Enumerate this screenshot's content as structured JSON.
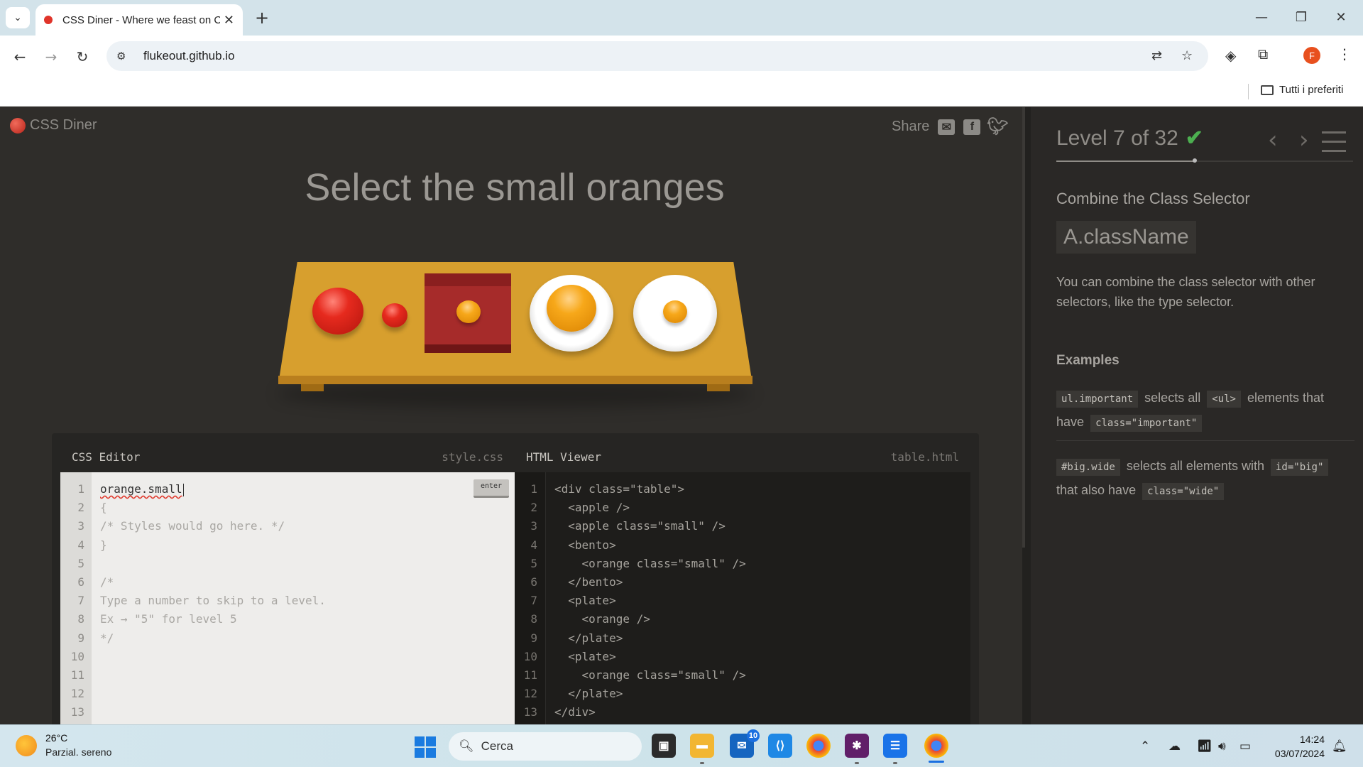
{
  "browser": {
    "tab_title": "CSS Diner - Where we feast on CSS Selectors!",
    "url": "flukeout.github.io",
    "bookmarks_folder": "Tutti i preferiti",
    "profile_initial": "F"
  },
  "game": {
    "logo": "CSS Diner",
    "share_label": "Share",
    "instruction": "Select the small oranges"
  },
  "editor": {
    "css_title": "CSS Editor",
    "css_file": "style.css",
    "enter_label": "enter",
    "css_input": "orange.small",
    "css_lines": [
      "{",
      "/* Styles would go here. */",
      "}",
      "",
      "/*",
      "Type a number to skip to a level.",
      "Ex → \"5\" for level 5",
      "*/",
      "",
      "",
      "",
      ""
    ],
    "line_numbers": [
      "1",
      "2",
      "3",
      "4",
      "5",
      "6",
      "7",
      "8",
      "9",
      "10",
      "11",
      "12",
      "13"
    ],
    "html_title": "HTML Viewer",
    "html_file": "table.html",
    "html_lines": [
      "<div class=\"table\">",
      "  <apple />",
      "  <apple class=\"small\" />",
      "  <bento>",
      "    <orange class=\"small\" />",
      "  </bento>",
      "  <plate>",
      "    <orange />",
      "  </plate>",
      "  <plate>",
      "    <orange class=\"small\" />",
      "  </plate>",
      "</div>"
    ]
  },
  "sidebar": {
    "level_text": "Level 7 of 32",
    "level_current": 7,
    "level_total": 32,
    "selector_name": "Combine the Class Selector",
    "syntax": "A.className",
    "hint": "You can combine the class selector with other selectors, like the type selector.",
    "examples_title": "Examples",
    "example1": {
      "code": "ul.important",
      "t1": "selects all",
      "tag": "<ul>",
      "t2": "elements that have",
      "attr": "class=\"important\""
    },
    "example2": {
      "code": "#big.wide",
      "t1": "selects all elements with",
      "tag": "id=\"big\"",
      "t2": "that also have",
      "attr": "class=\"wide\""
    }
  },
  "taskbar": {
    "temperature": "26°C",
    "weather": "Parzial. sereno",
    "search_placeholder": "Cerca",
    "mail_badge": "10",
    "time": "14:24",
    "date": "03/07/2024"
  }
}
